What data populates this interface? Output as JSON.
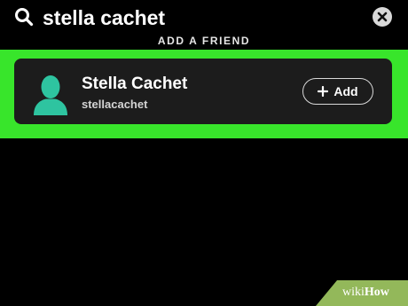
{
  "search": {
    "value": "stella cachet",
    "icon": "search-icon",
    "clear_icon": "close-icon"
  },
  "section": {
    "heading": "ADD A FRIEND"
  },
  "result": {
    "name": "Stella Cachet",
    "username": "stellacachet",
    "avatar_icon": "person-silhouette-icon",
    "avatar_color": "#2ec4a0",
    "add_label": "Add",
    "add_icon": "plus-icon"
  },
  "highlight_color": "#38e52b",
  "watermark": {
    "wiki": "wiki",
    "how": "How"
  }
}
